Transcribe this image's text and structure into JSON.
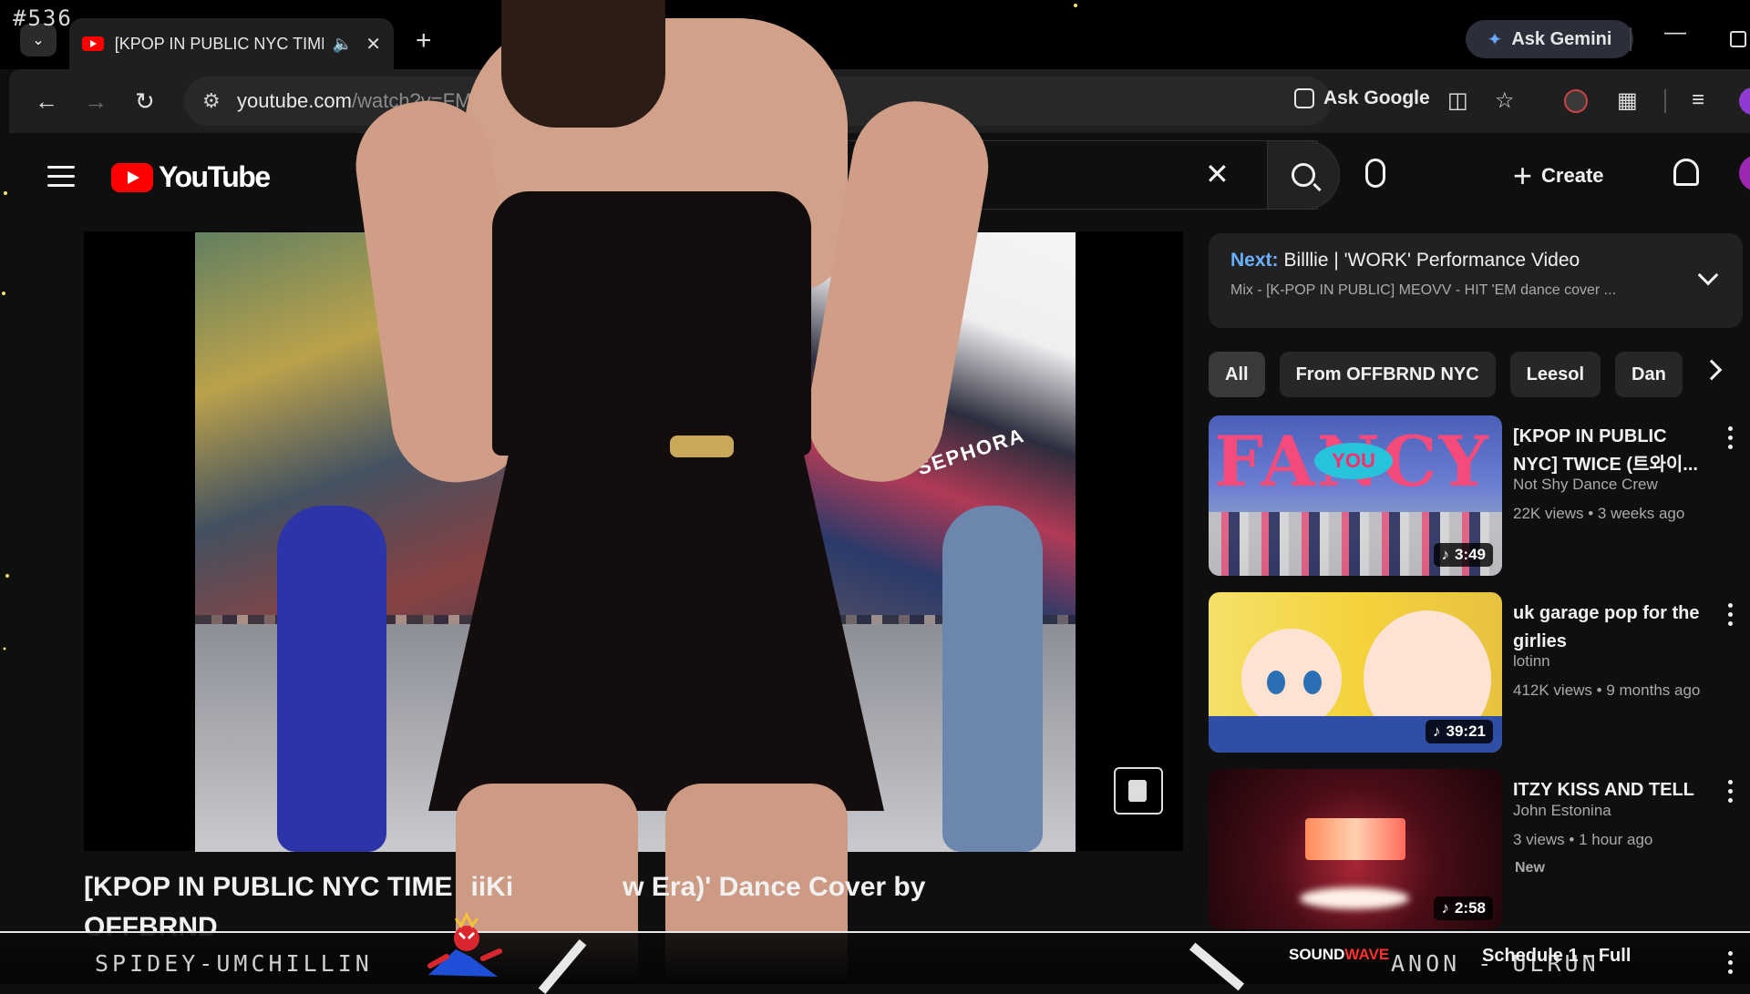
{
  "overlay": {
    "counter_tag": "#536",
    "handle_left": "SPIDEY-UMCHILLIN",
    "handle_right": "ANON - ULRUN",
    "now_playing_prefix": "SOUND",
    "now_playing_suffix": "WAVE"
  },
  "browser": {
    "tab_title": "[KPOP IN PUBLIC NYC TIMES",
    "gemini_label": "Ask Gemini",
    "url_host": "youtube.com",
    "url_path": "/watch?v=FM",
    "ask_google_label": "Ask Google"
  },
  "youtube": {
    "logo_text": "YouTube",
    "create_label": "Create"
  },
  "video": {
    "title_line1": "[KPOP IN PUBLIC NYC TIME",
    "title_mid": "iiKi",
    "title_tail": "w Era)' Dance Cover by",
    "title_line2": "OFFBRND",
    "sign_text": "SEPHORA"
  },
  "next_up": {
    "label": "Next:",
    "title": "Billlie | 'WORK' Performance Video",
    "subtitle": "Mix - [K-POP IN PUBLIC] MEOVV - HIT 'EM dance cover ..."
  },
  "chips": [
    "All",
    "From OFFBRND NYC",
    "Leesol",
    "Dan"
  ],
  "recommendations": [
    {
      "title": "[KPOP IN PUBLIC NYC] TWICE (트와이...",
      "channel": "Not Shy Dance Crew",
      "views": "22K views",
      "age": "3 weeks ago",
      "duration": "3:49",
      "thumb_word": "FANCY",
      "thumb_badge": "YOU"
    },
    {
      "title": "uk garage pop for the girlies",
      "channel": "lotinn",
      "views": "412K views",
      "age": "9 months ago",
      "duration": "39:21"
    },
    {
      "title": "ITZY KISS AND TELL",
      "channel": "John Estonina",
      "views": "3 views",
      "age": "1 hour ago",
      "badge": "New",
      "duration": "2:58"
    },
    {
      "title": "Schedule 1 – Full"
    }
  ]
}
